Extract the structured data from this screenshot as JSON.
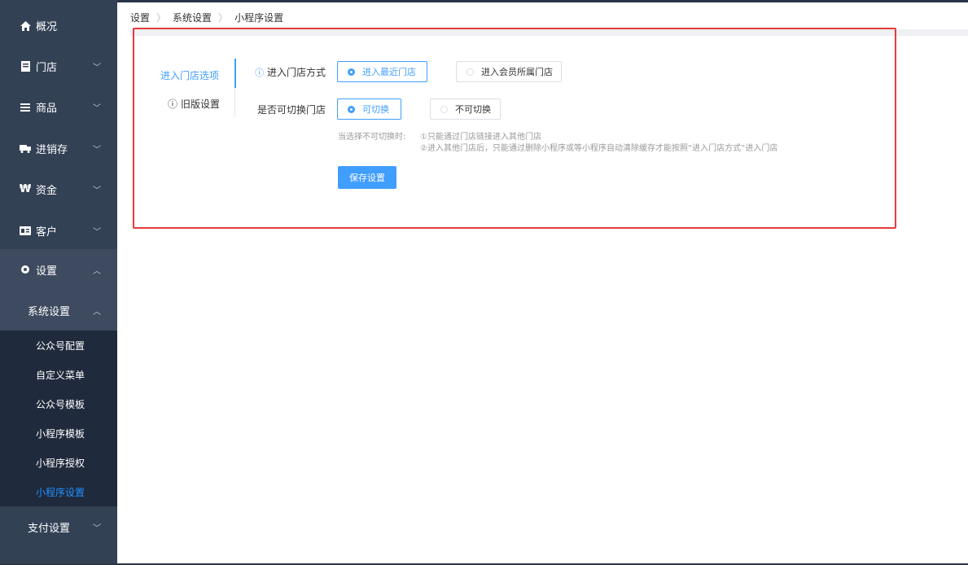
{
  "sidebar": {
    "items": [
      {
        "label": "概况",
        "icon": "home-icon",
        "glyph": "🏠",
        "has_chevron": false
      },
      {
        "label": "门店",
        "icon": "store-icon",
        "glyph": "▮",
        "has_chevron": true
      },
      {
        "label": "商品",
        "icon": "list-icon",
        "glyph": "≡",
        "has_chevron": true
      },
      {
        "label": "进销存",
        "icon": "truck-icon",
        "glyph": "◼",
        "has_chevron": true
      },
      {
        "label": "资金",
        "icon": "won-icon",
        "glyph": "₩",
        "has_chevron": true
      },
      {
        "label": "客户",
        "icon": "id-card-icon",
        "glyph": "▤",
        "has_chevron": true
      },
      {
        "label": "设置",
        "icon": "gear-icon",
        "glyph": "✿",
        "has_chevron": true,
        "expanded": true
      }
    ],
    "submenu_title": "系统设置",
    "submenu_items": [
      "公众号配置",
      "自定义菜单",
      "公众号模板",
      "小程序模板",
      "小程序授权",
      "小程序设置"
    ],
    "active_submenu": "小程序设置",
    "pay_settings": "支付设置"
  },
  "breadcrumb": [
    "设置",
    "系统设置",
    "小程序设置"
  ],
  "tabs": {
    "active": "进入门店选项",
    "old": "旧版设置"
  },
  "form": {
    "enter_mode_label": "进入门店方式",
    "enter_mode_options": [
      "进入最近门店",
      "进入会员所属门店"
    ],
    "enter_mode_selected": "进入最近门店",
    "switch_label": "是否可切换门店",
    "switch_options": [
      "可切换",
      "不可切换"
    ],
    "switch_selected": "可切换",
    "hint_prefix": "当选择不可切换时:",
    "hint_line1": "①只能通过门店链接进入其他门店",
    "hint_line2": "②进入其他门店后，只能通过删除小程序或等小程序自动清除缓存才能按照“进入门店方式”进入门店",
    "save_label": "保存设置"
  },
  "colors": {
    "sidebar_bg": "#334155",
    "submenu_bg": "#1f2a3c",
    "accent": "#409eff",
    "highlight_border": "#e63b3b"
  }
}
